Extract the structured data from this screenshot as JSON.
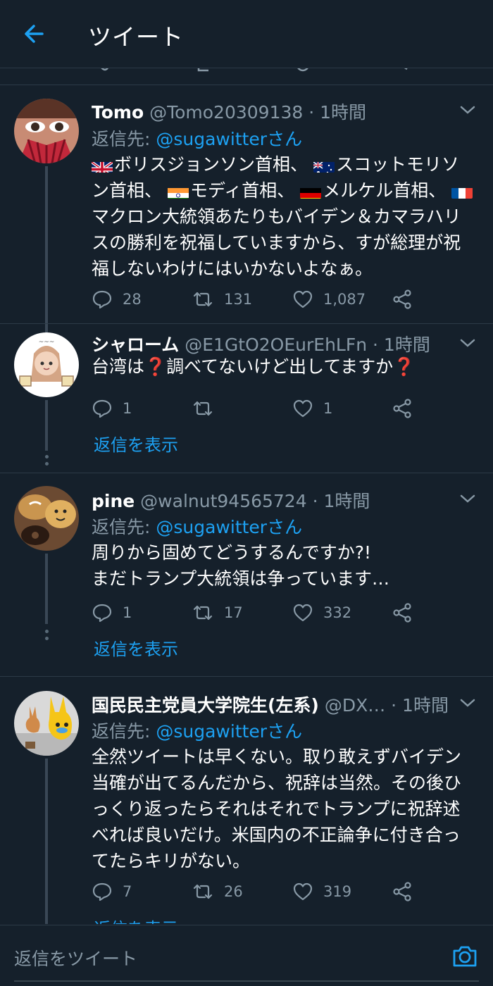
{
  "header": {
    "title": "ツイート"
  },
  "tweets": [
    {
      "name": "Tomo",
      "handle": "@Tomo20309138",
      "time": " · 1時間",
      "reply_to_prefix": "返信先: ",
      "reply_to": "@sugawitterさん",
      "body_segments": [
        "ボリスジョンソン首相、",
        "スコットモリソン首相、",
        "モディ首相、",
        "メルケル首相、",
        "マクロン大統領あたりもバイデン＆カマラハリスの勝利を祝福していますから、すが総理が祝福しないわけにはいかないよなぁ。"
      ],
      "flags": [
        "uk-flag",
        "australia-flag",
        "india-flag",
        "germany-flag",
        "france-flag"
      ],
      "replies": "28",
      "retweets": "131",
      "likes": "1,087"
    },
    {
      "name": "シャローム",
      "handle": "@E1GtO2OEurEhLFn",
      "time": " · 1時間",
      "body_segments": [
        "台湾は",
        "調べてないけど出してますか"
      ],
      "emoji": "❓",
      "replies": "1",
      "retweets": "",
      "likes": "1",
      "show_replies": "返信を表示"
    },
    {
      "name": "pine",
      "handle": "@walnut94565724",
      "time": " · 1時間",
      "reply_to_prefix": "返信先: ",
      "reply_to": "@sugawitterさん",
      "body_lines": [
        "周りから固めてどうするんですか?!",
        "まだトランプ大統領は争っています…"
      ],
      "replies": "1",
      "retweets": "17",
      "likes": "332",
      "show_replies": "返信を表示"
    },
    {
      "name": "国民民主党員大学院生(左系)",
      "handle": "@DX…",
      "time": " · 1時間",
      "reply_to_prefix": "返信先: ",
      "reply_to": "@sugawitterさん",
      "body": "全然ツイートは早くない。取り敢えずバイデン当確が出てるんだから、祝辞は当然。その後ひっくり返ったらそれはそれでトランプに祝辞述べれば良いだけ。米国内の不正論争に付き合ってたらキリがない。",
      "replies": "7",
      "retweets": "26",
      "likes": "319",
      "show_replies": "返信を表示"
    }
  ],
  "composer": {
    "placeholder": "返信をツイート"
  },
  "colors": {
    "background": "#15202b",
    "accent": "#1da1f2",
    "muted": "#8899a6",
    "divider": "#2c3a47"
  }
}
